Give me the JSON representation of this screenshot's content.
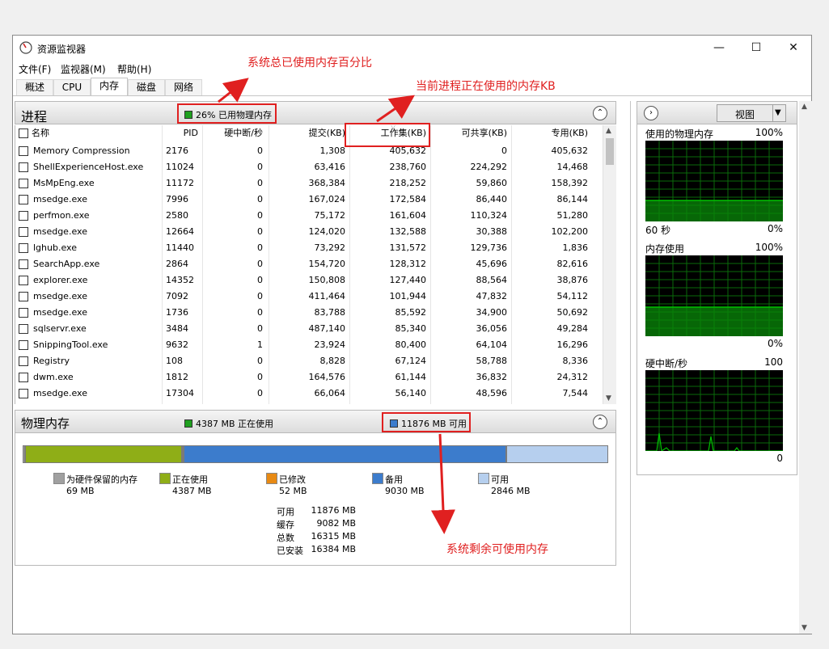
{
  "window": {
    "title": "资源监视器",
    "min_icon": "minimize-icon",
    "max_icon": "maximize-icon",
    "close_icon": "close-icon",
    "min_glyph": "—",
    "max_glyph": "☐",
    "close_glyph": "✕"
  },
  "menu": [
    "文件(F)",
    "监视器(M)",
    "帮助(H)"
  ],
  "tabs": [
    "概述",
    "CPU",
    "内存",
    "磁盘",
    "网络"
  ],
  "active_tab": "内存",
  "processes": {
    "title": "进程",
    "summary": "26% 已用物理内存",
    "summary_color": "#1fa01f",
    "collapse_glyph": "⌃",
    "columns": [
      "名称",
      "PID",
      "硬中断/秒",
      "提交(KB)",
      "工作集(KB)",
      "可共享(KB)",
      "专用(KB)"
    ],
    "sorted_column": "工作集(KB)",
    "rows": [
      [
        "Memory Compression",
        "2176",
        "0",
        "1,308",
        "405,632",
        "0",
        "405,632"
      ],
      [
        "ShellExperienceHost.exe",
        "11024",
        "0",
        "63,416",
        "238,760",
        "224,292",
        "14,468"
      ],
      [
        "MsMpEng.exe",
        "11172",
        "0",
        "368,384",
        "218,252",
        "59,860",
        "158,392"
      ],
      [
        "msedge.exe",
        "7996",
        "0",
        "167,024",
        "172,584",
        "86,440",
        "86,144"
      ],
      [
        "perfmon.exe",
        "2580",
        "0",
        "75,172",
        "161,604",
        "110,324",
        "51,280"
      ],
      [
        "msedge.exe",
        "12664",
        "0",
        "124,020",
        "132,588",
        "30,388",
        "102,200"
      ],
      [
        "lghub.exe",
        "11440",
        "0",
        "73,292",
        "131,572",
        "129,736",
        "1,836"
      ],
      [
        "SearchApp.exe",
        "2864",
        "0",
        "154,720",
        "128,312",
        "45,696",
        "82,616"
      ],
      [
        "explorer.exe",
        "14352",
        "0",
        "150,808",
        "127,440",
        "88,564",
        "38,876"
      ],
      [
        "msedge.exe",
        "7092",
        "0",
        "411,464",
        "101,944",
        "47,832",
        "54,112"
      ],
      [
        "msedge.exe",
        "1736",
        "0",
        "83,788",
        "85,592",
        "34,900",
        "50,692"
      ],
      [
        "sqlservr.exe",
        "3484",
        "0",
        "487,140",
        "85,340",
        "36,056",
        "49,284"
      ],
      [
        "SnippingTool.exe",
        "9632",
        "1",
        "23,924",
        "80,400",
        "64,104",
        "16,296"
      ],
      [
        "Registry",
        "108",
        "0",
        "8,828",
        "67,124",
        "58,788",
        "8,336"
      ],
      [
        "dwm.exe",
        "1812",
        "0",
        "164,576",
        "61,144",
        "36,832",
        "24,312"
      ],
      [
        "msedge.exe",
        "17304",
        "0",
        "66,064",
        "56,140",
        "48,596",
        "7,544"
      ]
    ]
  },
  "physical_memory": {
    "title": "物理内存",
    "in_use_summary": "4387 MB 正在使用",
    "available_summary": "11876 MB 可用",
    "bar": [
      {
        "name": "为硬件保留的内存",
        "value": 69,
        "color": "#a0a0a0"
      },
      {
        "name": "正在使用",
        "value": 4387,
        "color": "#8fae17"
      },
      {
        "name": "已修改",
        "value": 52,
        "color": "#e88a14"
      },
      {
        "name": "备用",
        "value": 9030,
        "color": "#3c7ccc"
      },
      {
        "name": "可用",
        "value": 2846,
        "color": "#b6cfee"
      }
    ],
    "legend": [
      {
        "label": "为硬件保留的内存",
        "value": "69 MB",
        "color": "#a0a0a0"
      },
      {
        "label": "正在使用",
        "value": "4387 MB",
        "color": "#8fae17"
      },
      {
        "label": "已修改",
        "value": "52 MB",
        "color": "#e88a14"
      },
      {
        "label": "备用",
        "value": "9030 MB",
        "color": "#3c7ccc"
      },
      {
        "label": "可用",
        "value": "2846 MB",
        "color": "#b6cfee"
      }
    ],
    "stats": [
      {
        "label": "可用",
        "value": "11876 MB"
      },
      {
        "label": "缓存",
        "value": "9082 MB"
      },
      {
        "label": "总数",
        "value": "16315 MB"
      },
      {
        "label": "已安装",
        "value": "16384 MB"
      }
    ]
  },
  "right_panel": {
    "expand_glyph": "›",
    "view_label": "视图",
    "dropdown_glyph": "▼",
    "graphs": [
      {
        "title": "使用的物理内存",
        "max": "100%",
        "left_bottom": "60 秒",
        "min": "0%",
        "level": 0.26
      },
      {
        "title": "内存使用",
        "max": "100%",
        "left_bottom": "",
        "min": "0%",
        "level": 0.36
      },
      {
        "title": "硬中断/秒",
        "max": "100",
        "left_bottom": "",
        "min": "0",
        "level": 0
      }
    ]
  },
  "annotations": [
    {
      "text": "系统总已使用内存百分比"
    },
    {
      "text": "当前进程正在使用的内存KB"
    },
    {
      "text": "系统剩余可使用内存"
    }
  ],
  "colors": {
    "accent_red": "#e02020",
    "graph_green": "#00c000",
    "graph_fill": "#0a8a0a"
  }
}
